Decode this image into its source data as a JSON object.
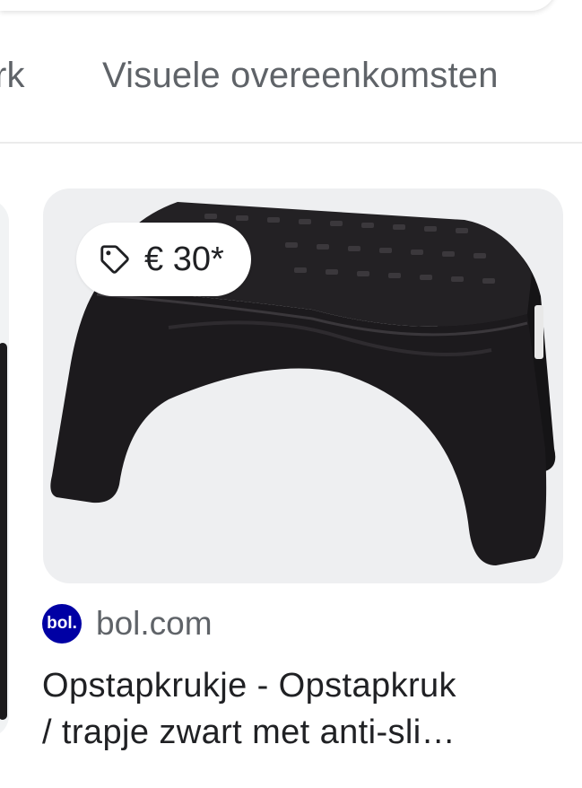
{
  "tabs": {
    "prev_partial": "rk",
    "visual_matches": "Visuele overeenkomsten"
  },
  "result": {
    "price": "€ 30*",
    "source": "bol.com",
    "favicon_text": "bol.",
    "title_line1": "Opstapkrukje - Opstapkruk",
    "title_line2": "/ trapje zwart met anti-sli…",
    "icons": [
      "price-tag-icon",
      "bol-favicon"
    ]
  },
  "colors": {
    "brand_bol": "#0000a4",
    "card_bg": "#eeeff1",
    "text_primary": "#202124",
    "text_secondary": "#5f6368"
  }
}
